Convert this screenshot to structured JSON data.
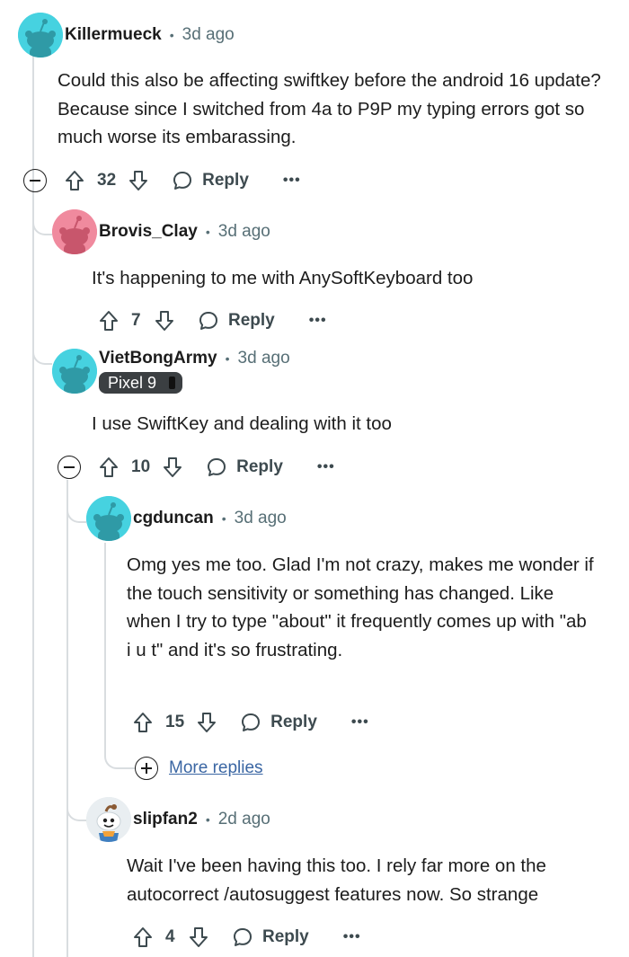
{
  "comments": [
    {
      "author": "Killermueck",
      "time": "3d ago",
      "body": "Could this also be affecting swiftkey before the android 16 update? Because since I switched from 4a to P9P my typing errors got so much worse its embarassing.",
      "votes": "32",
      "reply_label": "Reply",
      "more_label": "•••",
      "avatar_color": "#46d2e0"
    },
    {
      "author": "Brovis_Clay",
      "time": "3d ago",
      "body": "It's happening to me with AnySoftKeyboard too",
      "votes": "7",
      "reply_label": "Reply",
      "more_label": "•••",
      "avatar_color": "#f08a9e"
    },
    {
      "author": "VietBongArmy",
      "time": "3d ago",
      "flair": "Pixel 9",
      "body": "I use SwiftKey and dealing with it too",
      "votes": "10",
      "reply_label": "Reply",
      "more_label": "•••",
      "avatar_color": "#46d2e0"
    },
    {
      "author": "cgduncan",
      "time": "3d ago",
      "body": "Omg yes me too. Glad I'm not crazy, makes me wonder if the touch sensitivity or something has changed. Like when I try to type \"about\" it frequently comes up with \"ab i u t\" and it's so frustrating.",
      "votes": "15",
      "reply_label": "Reply",
      "more_label": "•••",
      "avatar_color": "#46d2e0"
    },
    {
      "author": "slipfan2",
      "time": "2d ago",
      "body": "Wait I've been having this too. I rely far more on the autocorrect /autosuggest features now. So strange",
      "votes": "4",
      "reply_label": "Reply",
      "more_label": "•••",
      "avatar_color": "#dfe6ea"
    }
  ],
  "more_replies_label": "More replies",
  "separator": "•"
}
